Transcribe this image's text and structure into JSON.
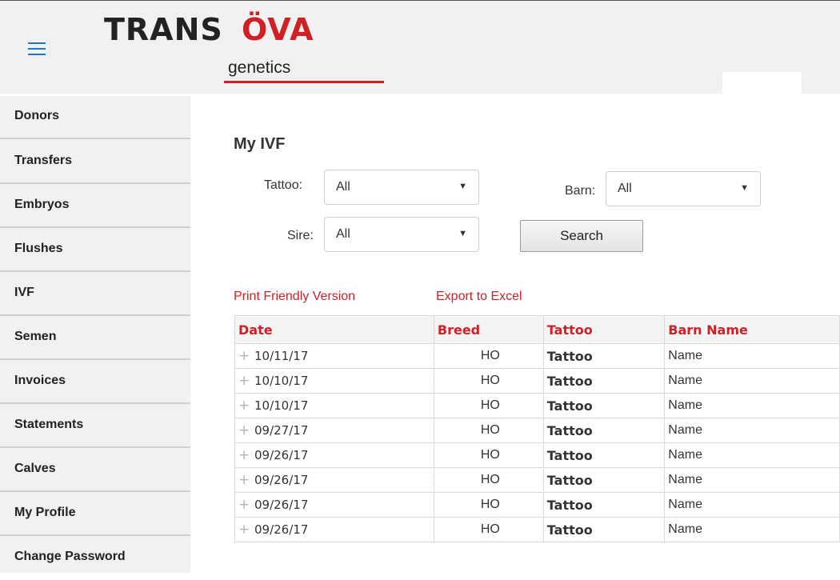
{
  "header": {
    "logo": {
      "word_left": "TRANS",
      "word_right": "ÖVA",
      "sub": "genetics"
    },
    "menu_icon": "hamburger-menu-icon"
  },
  "sidebar": {
    "items": [
      {
        "label": "Donors"
      },
      {
        "label": "Transfers"
      },
      {
        "label": "Embryos"
      },
      {
        "label": "Flushes"
      },
      {
        "label": "IVF"
      },
      {
        "label": "Semen"
      },
      {
        "label": "Invoices"
      },
      {
        "label": "Statements"
      },
      {
        "label": "Calves"
      },
      {
        "label": "My Profile"
      },
      {
        "label": "Change Password"
      }
    ]
  },
  "main": {
    "title": "My IVF",
    "filters": {
      "tattoo": {
        "label": "Tattoo:",
        "value": "All"
      },
      "barn": {
        "label": "Barn:",
        "value": "All"
      },
      "sire": {
        "label": "Sire:",
        "value": "All"
      }
    },
    "search_button": "Search",
    "links": {
      "print": "Print Friendly Version",
      "export": "Export to Excel"
    },
    "table": {
      "headers": [
        "Date",
        "Breed",
        "Tattoo",
        "Barn Name"
      ],
      "rows": [
        {
          "date": "10/11/17",
          "breed": "HO",
          "tattoo": "Tattoo",
          "barn": "Name"
        },
        {
          "date": "10/10/17",
          "breed": "HO",
          "tattoo": "Tattoo",
          "barn": "Name"
        },
        {
          "date": "10/10/17",
          "breed": "HO",
          "tattoo": "Tattoo",
          "barn": "Name"
        },
        {
          "date": "09/27/17",
          "breed": "HO",
          "tattoo": "Tattoo",
          "barn": "Name"
        },
        {
          "date": "09/26/17",
          "breed": "HO",
          "tattoo": "Tattoo",
          "barn": "Name"
        },
        {
          "date": "09/26/17",
          "breed": "HO",
          "tattoo": "Tattoo",
          "barn": "Name"
        },
        {
          "date": "09/26/17",
          "breed": "HO",
          "tattoo": "Tattoo",
          "barn": "Name"
        },
        {
          "date": "09/26/17",
          "breed": "HO",
          "tattoo": "Tattoo",
          "barn": "Name"
        }
      ]
    }
  },
  "colors": {
    "accent": "#d11f26",
    "menu_icon": "#1f77c0",
    "sidebar_bg": "#f1f1f1"
  }
}
